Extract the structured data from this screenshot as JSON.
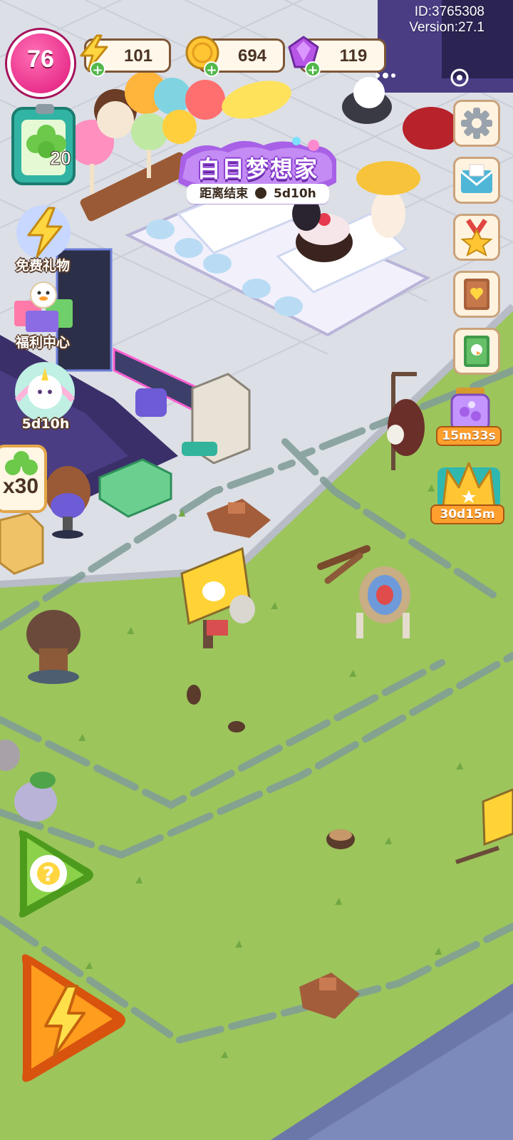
{
  "header": {
    "id_text": "ID:3765308",
    "version_text": "Version:27.1"
  },
  "player": {
    "level": "76"
  },
  "resources": {
    "energy": {
      "value": "101",
      "icon": "lightning-icon"
    },
    "coins": {
      "value": "694",
      "icon": "coin-icon"
    },
    "gems": {
      "value": "119",
      "icon": "gem-icon"
    }
  },
  "left_panel": {
    "task_count": "20",
    "free_gift_label": "免费礼物",
    "welfare_label": "福利中心",
    "unicorn_timer": "5d10h",
    "reward_multiplier": "x30"
  },
  "event": {
    "title": "白日梦想家",
    "end_label": "距离结束",
    "remaining": "5d10h"
  },
  "right_panel": {
    "jar_timer": "15m33s",
    "crown_timer": "30d15m"
  },
  "colors": {
    "grass": "#9cc55c",
    "plot_line": "#7b9aa0",
    "accent_pink": "#e0187a",
    "banner_purple": "#a760e6",
    "timer_orange": "#ff9f2e"
  }
}
